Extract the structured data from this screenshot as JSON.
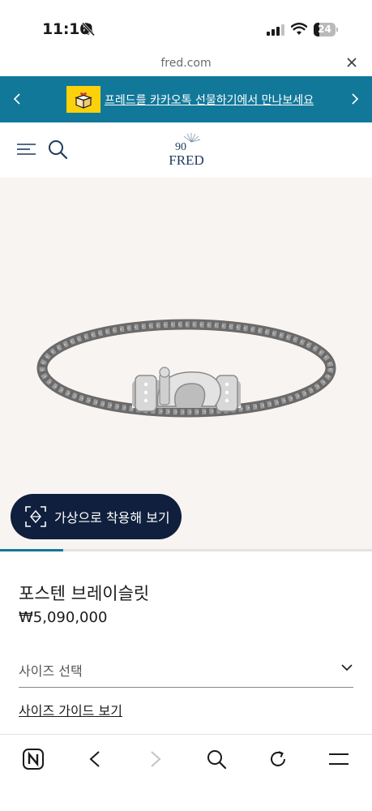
{
  "status": {
    "time": "11:16",
    "battery": "24"
  },
  "browser": {
    "url": "fred.com"
  },
  "promo": {
    "text": "프레드를 카카오톡 선물하기에서 만나보세요"
  },
  "header": {
    "logo_text": "FRED",
    "logo_badge": "90"
  },
  "gallery": {
    "progress": 0.17
  },
  "try_on": {
    "label": "가상으로 착용해 보기"
  },
  "product": {
    "name": "포스텐 브레이슬릿",
    "price": "₩5,090,000"
  },
  "size": {
    "label": "사이즈 선택",
    "guide": "사이즈 가이드 보기"
  },
  "colors": {
    "teal": "#12789a",
    "navy": "#0f1f3d",
    "gift_yellow": "#fbd10a",
    "image_bg": "#f8f4f1"
  },
  "icons": [
    "bell-slash-icon",
    "signal-icon",
    "wifi-icon",
    "close-icon",
    "chevron-left-icon",
    "chevron-right-icon",
    "gift-icon",
    "menu-icon",
    "search-icon",
    "ar-icon",
    "chevron-down-icon",
    "n-app-icon",
    "back-icon",
    "forward-icon",
    "refresh-icon",
    "hamburger-icon"
  ]
}
